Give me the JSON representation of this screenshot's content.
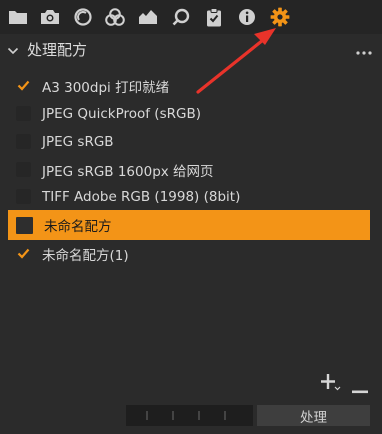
{
  "toolbar": {
    "tools": [
      {
        "icon": "folder-icon"
      },
      {
        "icon": "camera-icon"
      },
      {
        "icon": "lens-icon"
      },
      {
        "icon": "color-icon"
      },
      {
        "icon": "exposure-icon"
      },
      {
        "icon": "search-icon"
      },
      {
        "icon": "clipboard-icon"
      },
      {
        "icon": "info-icon"
      },
      {
        "icon": "gear-icon",
        "active": true
      }
    ],
    "active_color": "#f39417"
  },
  "panel": {
    "title": "处理配方",
    "recipes": [
      {
        "label": "A3 300dpi 打印就绪",
        "checked": true,
        "selected": false
      },
      {
        "label": "JPEG QuickProof (sRGB)",
        "checked": false,
        "selected": false
      },
      {
        "label": "JPEG sRGB",
        "checked": false,
        "selected": false
      },
      {
        "label": "JPEG sRGB 1600px 给网页",
        "checked": false,
        "selected": false
      },
      {
        "label": "TIFF Adobe RGB (1998) (8bit)",
        "checked": false,
        "selected": false
      },
      {
        "label": "未命名配方",
        "checked": false,
        "selected": true
      },
      {
        "label": "未命名配方(1)",
        "checked": true,
        "selected": false
      }
    ]
  },
  "footer": {
    "process_label": "处理"
  },
  "colors": {
    "accent": "#f39417",
    "annotation_arrow": "#e8332a"
  }
}
